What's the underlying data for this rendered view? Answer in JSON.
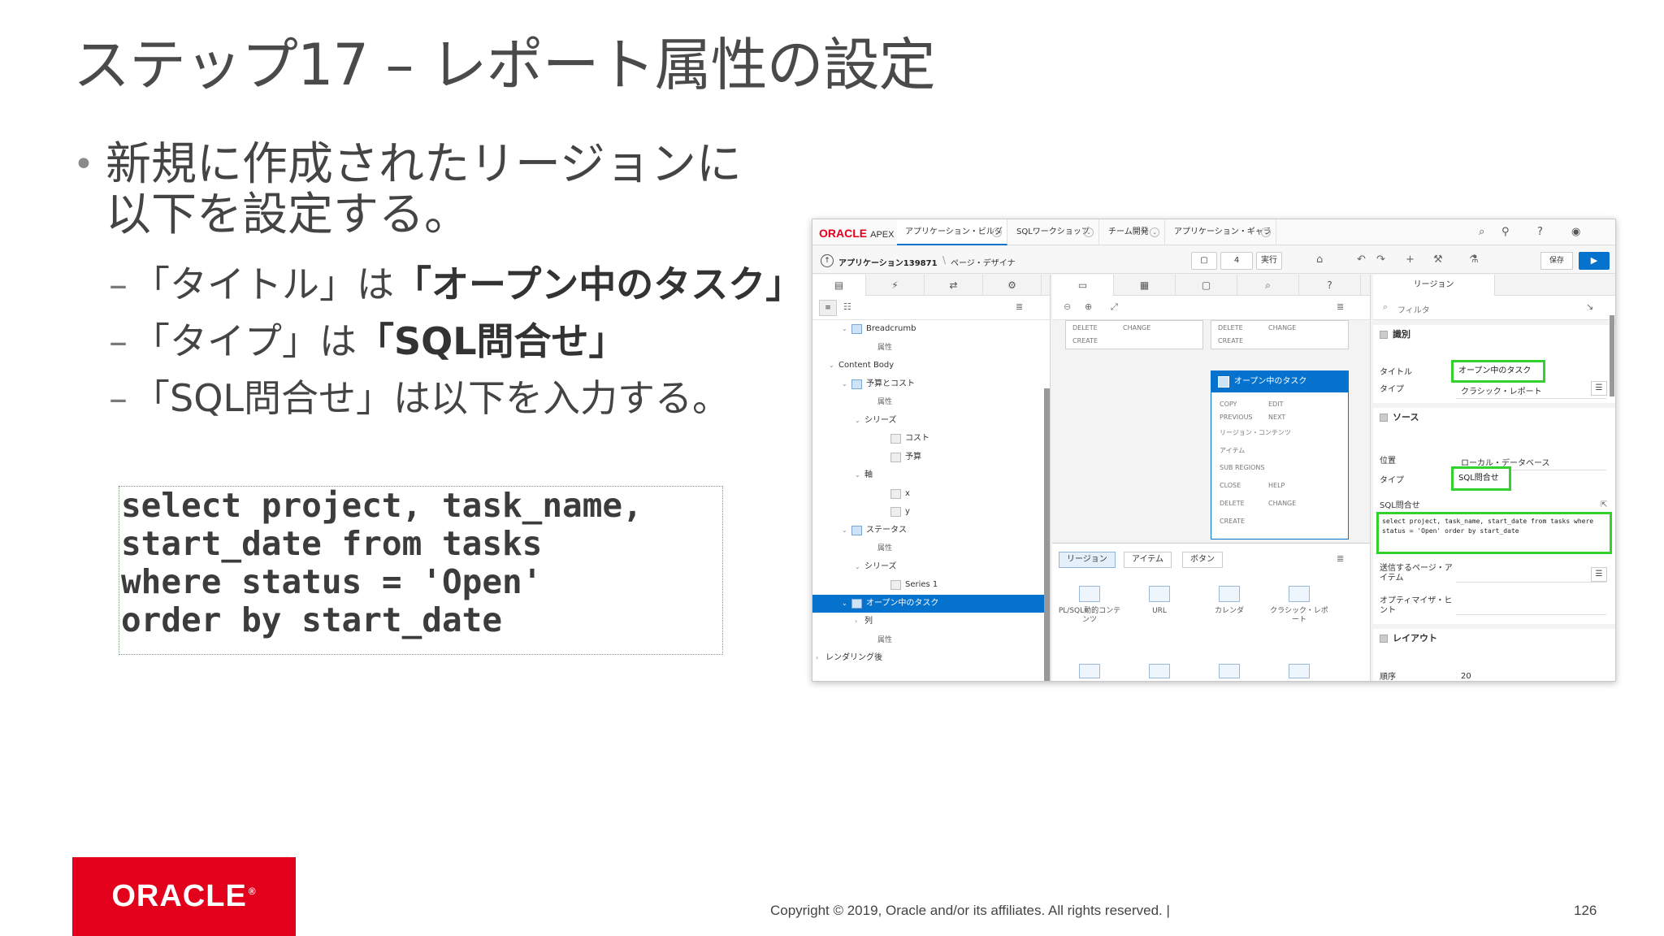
{
  "slide": {
    "title": "ステップ17 – レポート属性の設定",
    "bullet_dot": "•",
    "bullet_main": "新規に作成されたリージョンに以下を設定する。",
    "dash": "–",
    "sub1_prefix": "「タイトル」は",
    "sub1_value": "「オープン中のタスク」",
    "sub2_prefix": "「タイプ」は",
    "sub2_value": "「SQL問合せ」",
    "sub3": "「SQL問合せ」は以下を入力する。",
    "code": "select project, task_name,\nstart_date from tasks\nwhere status = 'Open'\norder by start_date",
    "logo": "ORACLE",
    "logo_reg": "®",
    "copyright": "Copyright © 2019, Oracle and/or its affiliates. All rights reserved.  |",
    "page_number": "126"
  },
  "apex": {
    "logo": "ORACLE",
    "logo_suffix": "APEX",
    "top_tabs": [
      "アプリケーション・ビルダー",
      "SQLワークショップ",
      "チーム開発",
      "アプリケーション・ギャラリ"
    ],
    "chevron": "⌄",
    "breadcrumb": {
      "app": "アプリケーション139871",
      "sep": "\\",
      "page": "ページ・デザイナ"
    },
    "page_no": "4",
    "run_label": "実行",
    "save_label": "保存",
    "left_tree": [
      {
        "label": "Breadcrumb",
        "indent": 2,
        "icon": true,
        "twisty": "⌄"
      },
      {
        "label": "属性",
        "indent": 4,
        "attr": true
      },
      {
        "label": "Content Body",
        "indent": 1,
        "twisty": "⌄"
      },
      {
        "label": "予算とコスト",
        "indent": 2,
        "icon": true,
        "twisty": "⌄"
      },
      {
        "label": "属性",
        "indent": 4,
        "attr": true
      },
      {
        "label": "シリーズ",
        "indent": 3,
        "twisty": "⌄"
      },
      {
        "label": "コスト",
        "indent": 5,
        "icon": true,
        "gray": true
      },
      {
        "label": "予算",
        "indent": 5,
        "icon": true,
        "gray": true
      },
      {
        "label": "軸",
        "indent": 3,
        "twisty": "⌄"
      },
      {
        "label": "x",
        "indent": 5,
        "icon": true,
        "gray": true
      },
      {
        "label": "y",
        "indent": 5,
        "icon": true,
        "gray": true
      },
      {
        "label": "ステータス",
        "indent": 2,
        "icon": true,
        "twisty": "⌄"
      },
      {
        "label": "属性",
        "indent": 4,
        "attr": true
      },
      {
        "label": "シリーズ",
        "indent": 3,
        "twisty": "⌄"
      },
      {
        "label": "Series 1",
        "indent": 5,
        "icon": true,
        "gray": true
      },
      {
        "label": "オープン中のタスク",
        "indent": 2,
        "icon": true,
        "twisty": "⌄",
        "selected": true
      },
      {
        "label": "列",
        "indent": 3,
        "twisty": "›"
      },
      {
        "label": "属性",
        "indent": 4,
        "attr": true
      },
      {
        "label": "レンダリング後",
        "indent": 0,
        "twisty": "›"
      }
    ],
    "mid": {
      "box1": [
        "DELETE",
        "CHANGE",
        "CREATE"
      ],
      "box2": [
        "DELETE",
        "CHANGE",
        "CREATE"
      ],
      "region_title": "オープン中のタスク",
      "region_items": [
        "COPY",
        "EDIT",
        "PREVIOUS",
        "NEXT",
        "リージョン・コンテンツ",
        "アイテム",
        "SUB REGIONS",
        "CLOSE",
        "HELP",
        "DELETE",
        "CHANGE",
        "CREATE"
      ],
      "gallery_tabs": [
        "リージョン",
        "アイテム",
        "ボタン"
      ],
      "gallery_items": [
        "PL/SQL動的コンテンツ",
        "URL",
        "カレンダ",
        "クラシック・レポート"
      ]
    },
    "right": {
      "tab": "リージョン",
      "filter": "フィルタ",
      "sec_id": "識別",
      "title_label": "タイトル",
      "title_value": "オープン中のタスク",
      "type_label": "タイプ",
      "type_value": "クラシック・レポート",
      "sec_source": "ソース",
      "location_label": "位置",
      "location_value": "ローカル・データベース",
      "src_type_label": "タイプ",
      "src_type_value": "SQL問合せ",
      "sql_label": "SQL問合せ",
      "sql_value": "select project, task_name, start_date from tasks where status = 'Open' order by start_date",
      "submit_label": "送信するページ・アイテム",
      "opt_label": "オプティマイザ・ヒント",
      "sec_layout": "レイアウト",
      "seq_label": "順序",
      "seq_value": "20"
    }
  }
}
